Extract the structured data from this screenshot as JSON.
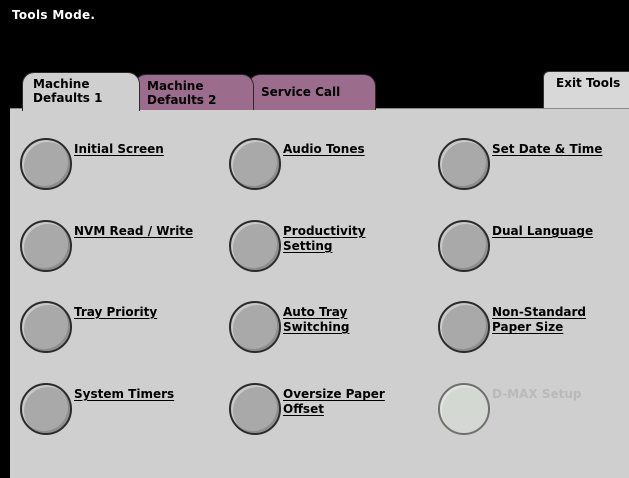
{
  "header": {
    "title": "Tools Mode."
  },
  "tabs": [
    {
      "line1": "Machine",
      "line2": "Defaults 1",
      "active": true
    },
    {
      "line1": "Machine",
      "line2": "Defaults 2",
      "active": false
    },
    {
      "line1": "Service Call",
      "line2": "",
      "active": false
    }
  ],
  "exit_button": {
    "label": "Exit Tools"
  },
  "colors": {
    "active_tab": "#cfcfcf",
    "inactive_tab": "#9c6c8c",
    "panel": "#cfcfcf",
    "background": "#000000"
  },
  "features": [
    {
      "line1": "Initial Screen",
      "line2": ""
    },
    {
      "line1": "NVM Read / Write",
      "line2": ""
    },
    {
      "line1": "Tray Priority",
      "line2": ""
    },
    {
      "line1": "System Timers",
      "line2": ""
    },
    {
      "line1": "Audio Tones",
      "line2": ""
    },
    {
      "line1": "Productivity",
      "line2": "Setting"
    },
    {
      "line1": "Auto Tray",
      "line2": "Switching"
    },
    {
      "line1": "Oversize Paper",
      "line2": "Offset"
    },
    {
      "line1": "Set Date & Time",
      "line2": ""
    },
    {
      "line1": "Dual Language",
      "line2": ""
    },
    {
      "line1": "Non-Standard",
      "line2": "Paper Size"
    },
    {
      "line1": "D-MAX Setup",
      "line2": "",
      "disabled": true
    }
  ]
}
